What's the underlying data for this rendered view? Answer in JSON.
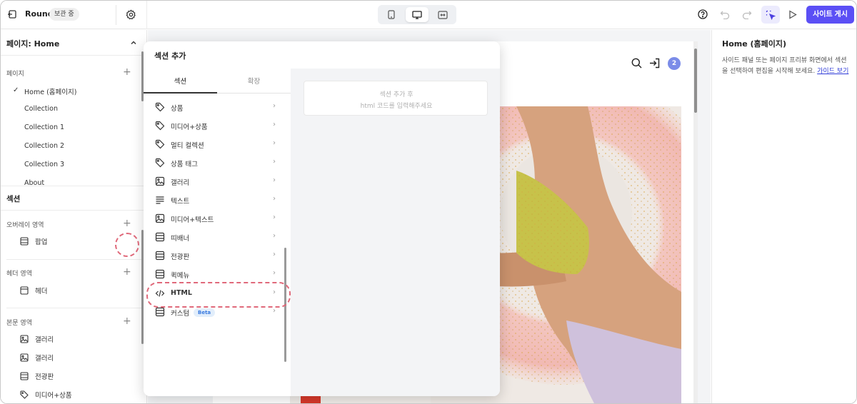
{
  "topbar": {
    "site_name": "Round",
    "storage_badge": "보관 중",
    "publish_label": "사이트 게시"
  },
  "sidebar": {
    "page_title": "페이지: Home",
    "pages_label": "페이지",
    "pages": [
      {
        "label": "Home (홈페이지)",
        "checked": true
      },
      {
        "label": "Collection"
      },
      {
        "label": "Collection 1"
      },
      {
        "label": "Collection 2"
      },
      {
        "label": "Collection 3"
      },
      {
        "label": "About"
      }
    ],
    "sections_title": "섹션",
    "overlay_label": "오버레이 영역",
    "overlay_items": [
      {
        "label": "팝업",
        "icon": "layout-icon"
      }
    ],
    "header_label": "헤더 영역",
    "header_items": [
      {
        "label": "헤더",
        "icon": "layout-icon"
      }
    ],
    "body_label": "본문 영역",
    "body_items": [
      {
        "label": "갤러리",
        "icon": "image-icon"
      },
      {
        "label": "갤러리",
        "icon": "image-icon"
      },
      {
        "label": "전광판",
        "icon": "layout-icon"
      },
      {
        "label": "미디어+상품",
        "icon": "tag-icon"
      }
    ]
  },
  "canvas": {
    "cart_count": "2"
  },
  "right_panel": {
    "title": "Home (홈페이지)",
    "description": "사이드 패널 또는 페이지 프리뷰 화면에서 섹션을 선택하여 편집을 시작해 보세요.",
    "guide_link": "가이드 보기"
  },
  "modal": {
    "title": "섹션 추가",
    "tab_section": "섹션",
    "tab_extension": "확장",
    "items": [
      {
        "label": "상품",
        "icon": "tag-icon"
      },
      {
        "label": "미디어+상품",
        "icon": "tag-icon"
      },
      {
        "label": "멀티 컬렉션",
        "icon": "tag-icon"
      },
      {
        "label": "상품 태그",
        "icon": "tag-icon"
      },
      {
        "label": "갤러리",
        "icon": "image-icon"
      },
      {
        "label": "텍스트",
        "icon": "text-icon"
      },
      {
        "label": "미디어+텍스트",
        "icon": "image-icon"
      },
      {
        "label": "띠배너",
        "icon": "layout-icon"
      },
      {
        "label": "전광판",
        "icon": "layout-icon"
      },
      {
        "label": "퀵메뉴",
        "icon": "layout-icon"
      },
      {
        "label": "HTML",
        "icon": "code-icon"
      },
      {
        "label": "커스텀",
        "icon": "layout-icon",
        "badge": "Beta"
      }
    ],
    "html_hint_1": "섹션 추가 후",
    "html_hint_2": "html 코드를 입력해주세요"
  }
}
